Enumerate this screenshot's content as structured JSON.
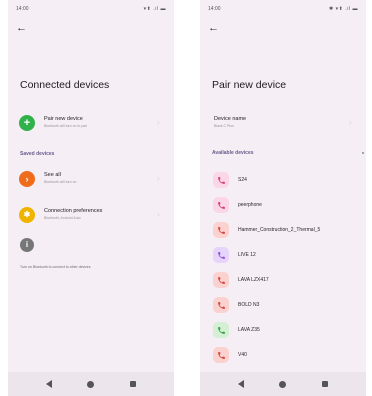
{
  "left": {
    "status": {
      "time": "14:00",
      "icons": "▾⬆ .ıl ▬"
    },
    "title": "Connected devices",
    "pair_new": {
      "label": "Pair new device",
      "sub": "Bluetooth will turn on to pair",
      "color": "#2fb24a"
    },
    "saved_header": "Saved devices",
    "see_all": {
      "label": "See all",
      "sub": "Bluetooth will turn on",
      "color": "#ef6c1a"
    },
    "conn_prefs": {
      "label": "Connection preferences",
      "sub": "Bluetooth, Android Auto",
      "color": "#f0b400"
    },
    "footer": "Turn on Bluetooth to connect to other devices"
  },
  "right": {
    "status": {
      "time": "14:00",
      "icons": "✱ ▾⬆ .ıl ▬"
    },
    "title": "Pair new device",
    "device_name": {
      "label": "Device name",
      "value": "Black C Plus"
    },
    "available_header": "Available devices",
    "devices": [
      {
        "name": "S24",
        "bg": "#fbd6e6",
        "fg": "#d13d7a"
      },
      {
        "name": "peerphone",
        "bg": "#fbd6e6",
        "fg": "#d13d7a"
      },
      {
        "name": "Hammer_Construction_2_Thermal_5",
        "bg": "#fbd2d0",
        "fg": "#d0453b"
      },
      {
        "name": "LIVE 12",
        "bg": "#e6d4fb",
        "fg": "#8b4fd6"
      },
      {
        "name": "LAVA LZX417",
        "bg": "#fbd2d0",
        "fg": "#d0453b"
      },
      {
        "name": "BOLD N3",
        "bg": "#fbd2d0",
        "fg": "#d0453b"
      },
      {
        "name": "LAVA Z35",
        "bg": "#d3f0d4",
        "fg": "#3a9c42"
      },
      {
        "name": "V40",
        "bg": "#fbd2d0",
        "fg": "#d0453b"
      }
    ]
  }
}
